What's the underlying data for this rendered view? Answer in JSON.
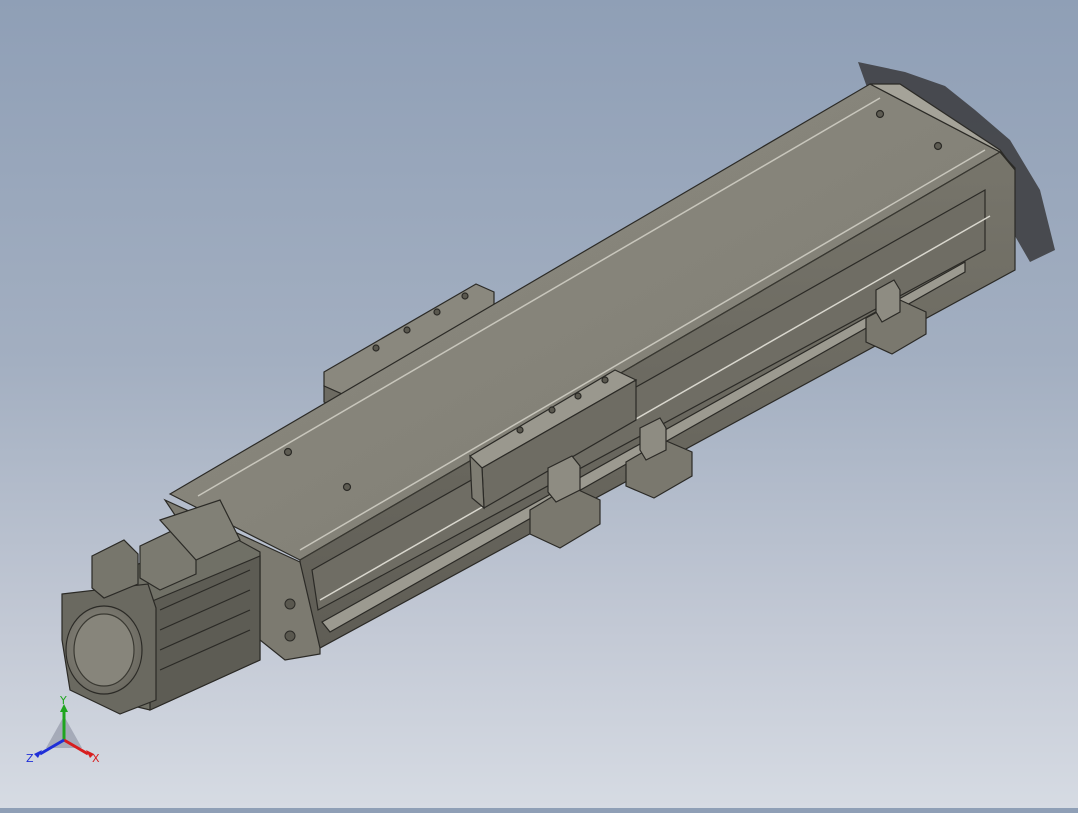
{
  "viewport": {
    "background_top": "#8f9fb6",
    "background_bottom": "#d6dbe3",
    "model_color": "#87857a",
    "edge_color": "#2b2a26"
  },
  "triad": {
    "x_label": "X",
    "y_label": "Y",
    "z_label": "Z",
    "x_color": "#d81e1e",
    "y_color": "#1fa51f",
    "z_color": "#1f2fd8"
  }
}
